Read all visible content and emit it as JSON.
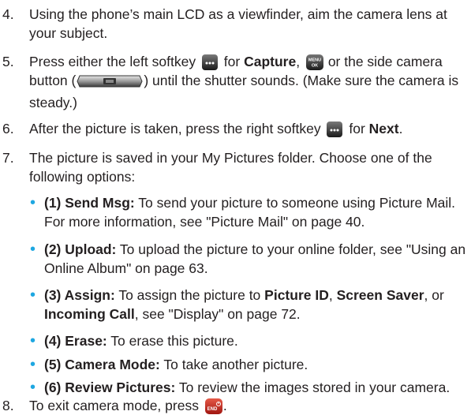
{
  "steps": [
    {
      "num": "4.",
      "text": "Using the phone’s main LCD as a viewfinder, aim the camera lens at your subject."
    },
    {
      "num": "5.",
      "t1": "Press either the left softkey ",
      "t2": " for ",
      "b1": "Capture",
      "t3": ", ",
      "t4": " or the side camera button (",
      "t5": ") until the shutter sounds. (Make sure the camera is steady.)"
    },
    {
      "num": "6.",
      "t1": "After the picture is taken, press the right softkey ",
      "t2": " for ",
      "b1": "Next",
      "t3": "."
    },
    {
      "num": "7.",
      "text": "The picture is saved in your My Pictures folder. Choose one of the following options:"
    },
    {
      "num": "8.",
      "t1": "To exit camera mode, press ",
      "t2": "."
    }
  ],
  "options": [
    {
      "label": "(1) Send Msg:",
      "text": " To send your picture to someone using Picture Mail. For more information, see \"Picture Mail\" on page 40."
    },
    {
      "label": "(2) Upload:",
      "text": " To upload the picture to your online folder, see \"Using an Online Album\" on page 63."
    },
    {
      "label": "(3) Assign:",
      "t1": " To assign the picture to ",
      "b1": "Picture ID",
      "t2": ", ",
      "b2": "Screen Saver",
      "t3": ", or ",
      "b3": "Incoming Call",
      "t4": ", see \"Display\" on page 72."
    },
    {
      "label": "(4) Erase:",
      "text": " To erase this picture."
    },
    {
      "label": "(5) Camera Mode:",
      "text": " To take another picture."
    },
    {
      "label": "(6) Review Pictures:",
      "text": " To review the images stored in your camera."
    }
  ],
  "icons": {
    "softkey": "softkey-icon",
    "menu_ok": "menu-ok-icon",
    "side_camera": "side-camera-button-icon",
    "end": "end-key-icon",
    "menu_ok_text_top": "MENU",
    "menu_ok_text_bottom": "OK",
    "end_text": "END"
  },
  "colors": {
    "bullet": "#1ea7e1",
    "text": "#231f20",
    "end_key": "#c8201e"
  }
}
